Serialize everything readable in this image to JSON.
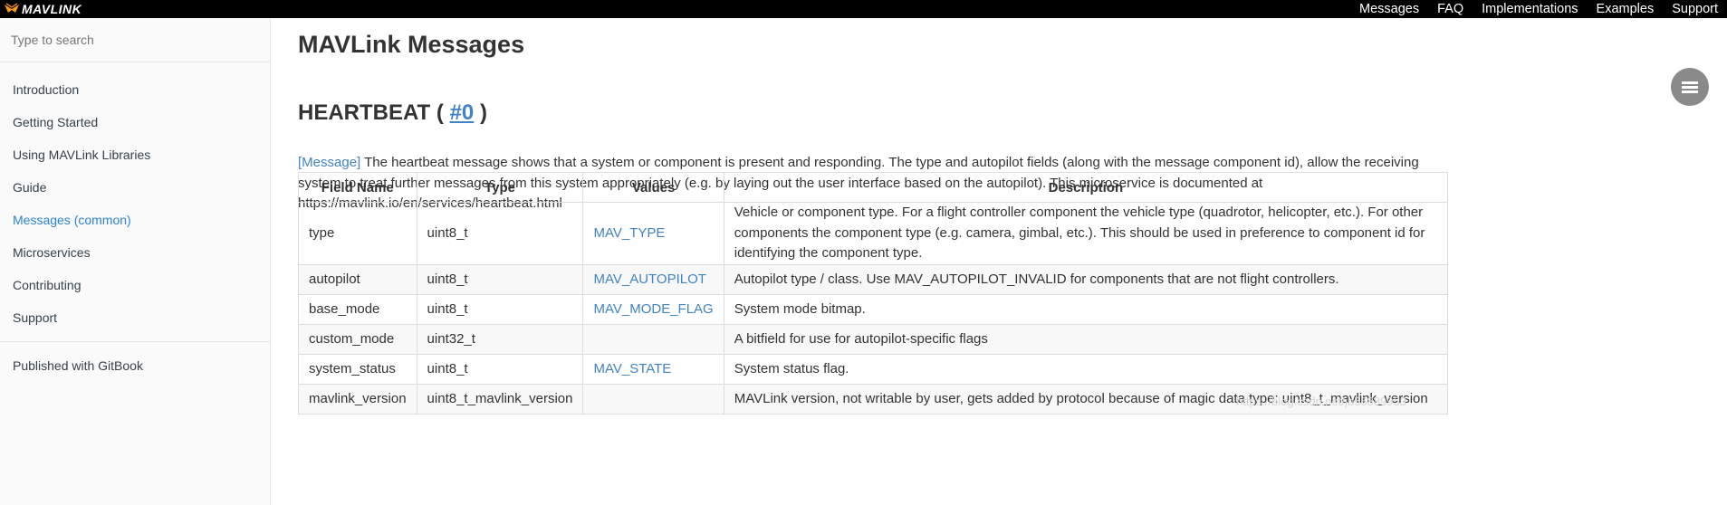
{
  "brand": {
    "logo_text": "MAVLINK"
  },
  "topnav": [
    "Messages",
    "FAQ",
    "Implementations",
    "Examples",
    "Support"
  ],
  "sidebar": {
    "search_placeholder": "Type to search",
    "items": [
      {
        "label": "Introduction"
      },
      {
        "label": "Getting Started"
      },
      {
        "label": "Using MAVLink Libraries"
      },
      {
        "label": "Guide"
      },
      {
        "label": "Messages (common)",
        "active": true
      },
      {
        "label": "Microservices"
      },
      {
        "label": "Contributing"
      },
      {
        "label": "Support"
      }
    ],
    "footer": "Published with GitBook"
  },
  "main": {
    "title": "MAVLink Messages",
    "heading_name": "HEARTBEAT",
    "heading_open": "(",
    "heading_id": "#0",
    "heading_close": ")",
    "desc_tag": "[Message]",
    "description": "The heartbeat message shows that a system or component is present and responding. The type and autopilot fields (along with the message component id), allow the receiving system to treat further messages from this system appropriately (e.g. by laying out the user interface based on the autopilot). This microservice is documented at https://mavlink.io/en/services/heartbeat.html",
    "table": {
      "headers": [
        "Field Name",
        "Type",
        "Values",
        "Description"
      ],
      "rows": [
        {
          "field": "type",
          "type": "uint8_t",
          "values": "MAV_TYPE",
          "description": "Vehicle or component type. For a flight controller component the vehicle type (quadrotor, helicopter, etc.). For other components the component type (e.g. camera, gimbal, etc.). This should be used in preference to component id for identifying the component type."
        },
        {
          "field": "autopilot",
          "type": "uint8_t",
          "values": "MAV_AUTOPILOT",
          "description": "Autopilot type / class. Use MAV_AUTOPILOT_INVALID for components that are not flight controllers."
        },
        {
          "field": "base_mode",
          "type": "uint8_t",
          "values": "MAV_MODE_FLAG",
          "description": "System mode bitmap."
        },
        {
          "field": "custom_mode",
          "type": "uint32_t",
          "values": "",
          "description": "A bitfield for use for autopilot-specific flags"
        },
        {
          "field": "system_status",
          "type": "uint8_t",
          "values": "MAV_STATE",
          "description": "System status flag."
        },
        {
          "field": "mavlink_version",
          "type": "uint8_t_mavlink_version",
          "values": "",
          "description": "MAVLink version, not writable by user, gets added by protocol because of magic data type: uint8_t_mavlink_version"
        }
      ]
    }
  },
  "watermark": "https://blog.csdn.net/jb56889953",
  "colors": {
    "link": "#4183c4",
    "topbar": "#000000",
    "active": "#2d82d1"
  }
}
